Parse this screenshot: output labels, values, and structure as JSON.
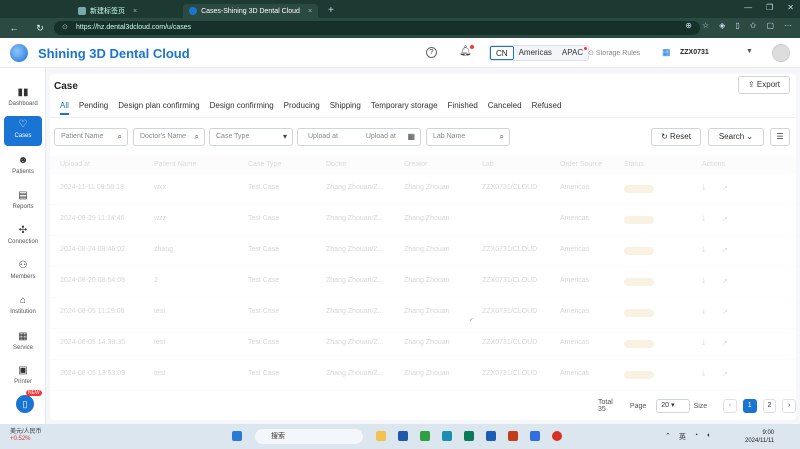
{
  "browser": {
    "tabs": [
      {
        "label": "新建标签页",
        "active": false
      },
      {
        "label": "Cases-Shining 3D Dental Cloud",
        "active": true
      }
    ],
    "url": "https://hz.dental3dcloud.com/u/cases"
  },
  "header": {
    "brand": "Shining 3D Dental Cloud",
    "regions": [
      "CN",
      "Americas",
      "APAC"
    ],
    "active_region": "CN",
    "storage_rules": "Storage Rules",
    "org": "ZZX0731"
  },
  "sidebar": {
    "items": [
      {
        "label": "Dashboard",
        "icon": "bar-chart-icon",
        "glyph": "▮▮"
      },
      {
        "label": "Cases",
        "icon": "tooth-icon",
        "glyph": "♡"
      },
      {
        "label": "Patients",
        "icon": "patients-icon",
        "glyph": "☻"
      },
      {
        "label": "Reports",
        "icon": "reports-icon",
        "glyph": "▤"
      },
      {
        "label": "Connection",
        "icon": "connection-icon",
        "glyph": "✣"
      },
      {
        "label": "Members",
        "icon": "members-icon",
        "glyph": "⚇"
      },
      {
        "label": "Institution",
        "icon": "institution-icon",
        "glyph": "⌂"
      },
      {
        "label": "Service",
        "icon": "service-icon",
        "glyph": "▦"
      },
      {
        "label": "Printer",
        "icon": "printer-icon",
        "glyph": "▣"
      }
    ],
    "new_badge": "NEW"
  },
  "main": {
    "title": "Case",
    "export_label": "Export",
    "tabs": [
      "All",
      "Pending",
      "Design plan confirming",
      "Design confirming",
      "Producing",
      "Shipping",
      "Temporary storage",
      "Finished",
      "Canceled",
      "Refused"
    ],
    "filters": {
      "patient_name": "Patient Name",
      "doctor_name": "Doctor's Name",
      "case_type": "Case Type",
      "upload_at_from": "Upload at",
      "upload_at_to": "Upload at",
      "lab_name": "Lab Name"
    },
    "reset_label": "Reset",
    "search_label": "Search",
    "columns": [
      "Upload at",
      "Patient Name",
      "Case Type",
      "Doctor",
      "Creator",
      "Lab",
      "Order Source",
      "Status",
      "Actions"
    ],
    "rows": [
      {
        "upload": "2024-11-11 09:58:18",
        "patient": "wxx",
        "type": "Test Case",
        "doctor": "Zhang Zhouan/Z...",
        "creator": "Zhang Zhouan",
        "lab": "ZZX0731/CLOUD",
        "source": "Americas"
      },
      {
        "upload": "2024-08-29 11:14:46",
        "patient": "wzz",
        "type": "Test Case",
        "doctor": "Zhang Zhouan/Z...",
        "creator": "Zhang Zhouan",
        "lab": "",
        "source": "Americas"
      },
      {
        "upload": "2024-08-24 08:46:02",
        "patient": "zhang",
        "type": "Test Case",
        "doctor": "Zhang Zhouan/Z...",
        "creator": "Zhang Zhouan",
        "lab": "ZZX0731/CLOUD",
        "source": "Americas"
      },
      {
        "upload": "2024-08-20 08:54:08",
        "patient": "2",
        "type": "Test Case",
        "doctor": "Zhang Zhouan/Z...",
        "creator": "Zhang Zhouan",
        "lab": "ZZX0731/CLOUD",
        "source": "Americas"
      },
      {
        "upload": "2024-08-05 11:29:05",
        "patient": "test",
        "type": "Test Case",
        "doctor": "Zhang Zhouan/Z...",
        "creator": "Zhang Zhouan",
        "lab": "ZZX0731/CLOUD",
        "source": "Americas"
      },
      {
        "upload": "2024-08-05 14:38:35",
        "patient": "test",
        "type": "Test Case",
        "doctor": "Zhang Zhouan/Z...",
        "creator": "Zhang Zhouan",
        "lab": "ZZX0731/CLOUD",
        "source": "Americas"
      },
      {
        "upload": "2024-08-05 13:53:09",
        "patient": "test",
        "type": "Test Case",
        "doctor": "Zhang Zhouan/Z...",
        "creator": "Zhang Zhouan",
        "lab": "ZZX0731/CLOUD",
        "source": "Americas"
      }
    ],
    "pagination": {
      "total": "Total 35",
      "page_label": "Page",
      "page_size": "20",
      "size_label": "Size",
      "pages": [
        "1",
        "2"
      ],
      "current": "1"
    }
  },
  "taskbar": {
    "weather_title": "美元/人民币",
    "weather_value": "+0.52%",
    "search": "搜索",
    "time": "9:00",
    "date": "2024/11/11"
  },
  "colors": {
    "accent": "#1a74d3",
    "chrome": "#1c3a32"
  }
}
